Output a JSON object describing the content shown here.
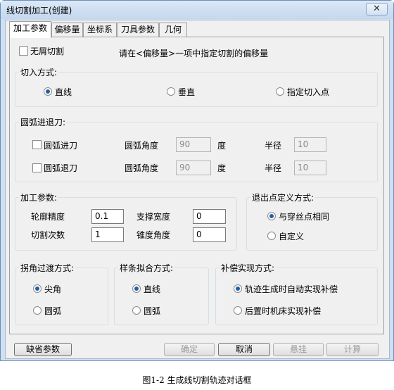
{
  "window": {
    "title": "线切割加工(创建)",
    "close_label": "✕"
  },
  "tabs": [
    "加工参数",
    "偏移量",
    "坐标系",
    "刀具参数",
    "几何"
  ],
  "top": {
    "no_chip_label": "无屑切割",
    "hint": "请在<偏移量>一项中指定切割的偏移量"
  },
  "cut_in": {
    "title": "切入方式:",
    "options": [
      "直线",
      "垂直",
      "指定切入点"
    ],
    "selected": "直线"
  },
  "arc": {
    "title": "圆弧进退刀:",
    "rows": [
      {
        "label": "圆弧进刀",
        "angle_label": "圆弧角度",
        "angle": "90",
        "deg": "度",
        "radius_label": "半径",
        "radius": "10"
      },
      {
        "label": "圆弧退刀",
        "angle_label": "圆弧角度",
        "angle": "90",
        "deg": "度",
        "radius_label": "半径",
        "radius": "10"
      }
    ]
  },
  "machining": {
    "title": "加工参数:",
    "contour_precision_label": "轮廓精度",
    "contour_precision": "0.1",
    "support_width_label": "支撑宽度",
    "support_width": "0",
    "cut_count_label": "切割次数",
    "cut_count": "1",
    "taper_angle_label": "锥度角度",
    "taper_angle": "0"
  },
  "exit_point": {
    "title": "退出点定义方式:",
    "options": [
      "与穿丝点相同",
      "自定义"
    ],
    "selected": "与穿丝点相同"
  },
  "corner": {
    "title": "拐角过渡方式:",
    "options": [
      "尖角",
      "圆弧"
    ],
    "selected": "尖角"
  },
  "spline": {
    "title": "样条拟合方式:",
    "options": [
      "直线",
      "圆弧"
    ],
    "selected": "直线"
  },
  "compensation": {
    "title": "补偿实现方式:",
    "options": [
      "轨迹生成时自动实现补偿",
      "后置时机床实现补偿"
    ],
    "selected": "轨迹生成时自动实现补偿"
  },
  "buttons": {
    "defaults": "缺省参数",
    "ok": "确定",
    "cancel": "取消",
    "suspend": "悬挂",
    "calculate": "计算"
  },
  "caption": "图1-2 生成线切割轨迹对话框"
}
